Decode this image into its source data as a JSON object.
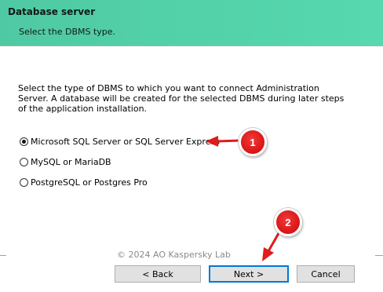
{
  "header": {
    "title": "Database server",
    "subtitle": "Select the DBMS type."
  },
  "content": {
    "description": "Select the type of DBMS to which you want to connect Administration Server. A database will be created for the selected DBMS during later steps of the application installation.",
    "options": [
      {
        "label": "Microsoft SQL Server or SQL Server Express",
        "selected": true
      },
      {
        "label": "MySQL or MariaDB",
        "selected": false
      },
      {
        "label": "PostgreSQL or Postgres Pro",
        "selected": false
      }
    ]
  },
  "footer": {
    "copyright": "© 2024 AO Kaspersky Lab",
    "back_label": "< Back",
    "next_label": "Next >",
    "cancel_label": "Cancel"
  },
  "annotations": {
    "badge1": "1",
    "badge2": "2",
    "color": "#e01b1b"
  },
  "colors": {
    "header_bg": "#52d0a8",
    "window_bg": "#f0f0f0",
    "content_bg": "#ffffff",
    "default_button_border": "#0078d7"
  }
}
